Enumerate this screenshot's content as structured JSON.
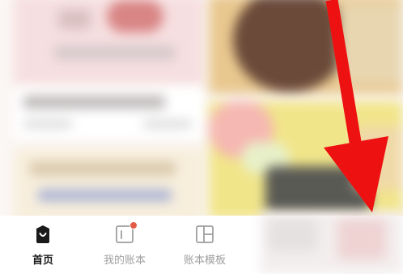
{
  "tabbar": {
    "tabs": [
      {
        "label": "首页",
        "icon": "home-bag-icon",
        "active": true
      },
      {
        "label": "我的账本",
        "icon": "ledger-icon",
        "active": false,
        "has_badge": true
      },
      {
        "label": "账本模板",
        "icon": "template-grid-icon",
        "active": false
      }
    ]
  },
  "colors": {
    "active_text": "#1a1a1a",
    "inactive_text": "#9e9e9e",
    "badge": "#e25b45",
    "arrow": "#ee1111"
  }
}
